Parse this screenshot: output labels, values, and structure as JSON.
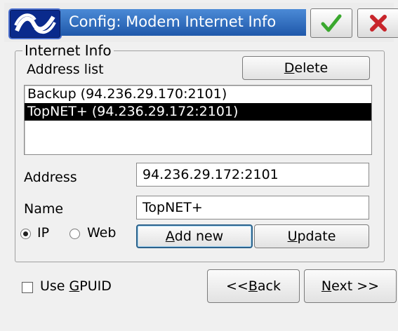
{
  "window": {
    "title": "Config: Modem Internet Info",
    "ok_icon": "checkmark-icon",
    "cancel_icon": "close-x-icon",
    "colors": {
      "title_bar": "#2f6cc0",
      "ok": "#3aa82e",
      "cancel": "#c8252b",
      "selection": "#000000"
    }
  },
  "internet_info": {
    "legend": "Internet Info",
    "address_list_label": "Address list",
    "delete_label_ul": "D",
    "delete_label_rest": "elete",
    "addresses": [
      {
        "text": "Backup (94.236.29.170:2101)",
        "selected": false
      },
      {
        "text": "TopNET+ (94.236.29.172:2101)",
        "selected": true
      }
    ],
    "address_label": "Address",
    "address_value": "94.236.29.172:2101",
    "name_label": "Name",
    "name_value": "TopNET+",
    "radio_ip_label": "IP",
    "radio_web_label": "Web",
    "selected_mode": "IP",
    "add_new_ul": "A",
    "add_new_rest": "dd new",
    "update_ul": "U",
    "update_rest": "pdate"
  },
  "footer": {
    "use_gpuid_pre": "Use ",
    "use_gpuid_ul": "G",
    "use_gpuid_rest": "PUID",
    "use_gpuid_checked": false,
    "back_pre": "<< ",
    "back_ul": "B",
    "back_rest": "ack",
    "next_ul": "N",
    "next_rest": "ext >>"
  }
}
